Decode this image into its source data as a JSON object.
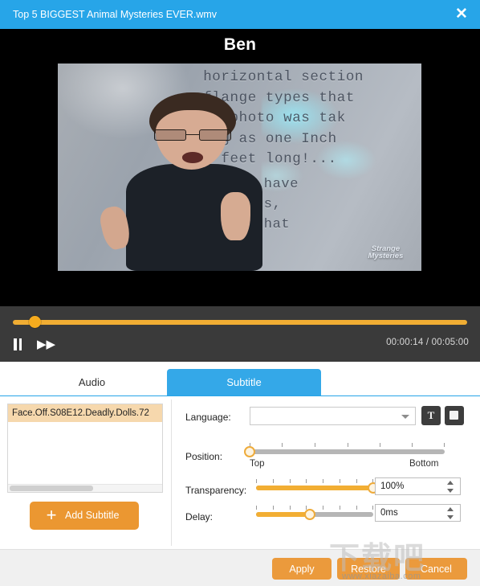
{
  "window": {
    "title": "Top 5 BIGGEST Animal Mysteries EVER.wmv",
    "close_label": "✕"
  },
  "video": {
    "overlay_title": "Ben",
    "background_text_upper": "horizontal section\nflange types that\nis photo was tak\ning as one Inch\no feet long!...",
    "background_text_lower": "\"There have\nt snakes,\nforms that\nn nor",
    "logo_line1": "Strange",
    "logo_line2": "Mysteries"
  },
  "player": {
    "pause_icon": "pause-icon",
    "forward_icon": "fast-forward-icon",
    "forward_glyph": "▶▶",
    "current_time": "00:00:14",
    "total_time": "00:05:00",
    "time_separator": "/",
    "timecode": "00:00:14 / 00:05:00",
    "progress_percent": 4.7,
    "accent_color": "#f0ad33"
  },
  "tabs": [
    {
      "id": "audio",
      "label": "Audio",
      "active": false
    },
    {
      "id": "subtitle",
      "label": "Subtitle",
      "active": true
    }
  ],
  "subtitle_panel": {
    "list_items": [
      {
        "label": "Face.Off.S08E12.Deadly.Dolls.72",
        "selected": true
      }
    ],
    "add_button_label": "Add Subtitle",
    "add_button_icon": "plus-icon",
    "plus_glyph": "+",
    "selected_color": "#f6d8ad",
    "button_color": "#eb9731"
  },
  "settings": {
    "language": {
      "label": "Language:",
      "value": "",
      "placeholder": ""
    },
    "font_button_icon": "font-icon",
    "font_button_glyph": "T",
    "color_button_icon": "color-swatch-icon",
    "position": {
      "label": "Position:",
      "value_percent": 0,
      "min_label": "Top",
      "max_label": "Bottom"
    },
    "transparency": {
      "label": "Transparency:",
      "value_percent": 100,
      "value_text": "100%"
    },
    "delay": {
      "label": "Delay:",
      "value_percent": 46,
      "value_text": "0ms"
    }
  },
  "footer": {
    "apply_label": "Apply",
    "restore_label": "Restore",
    "cancel_label": "Cancel"
  },
  "watermark": {
    "text_cn": "下载吧",
    "url": "www.xiazaiba.com"
  }
}
